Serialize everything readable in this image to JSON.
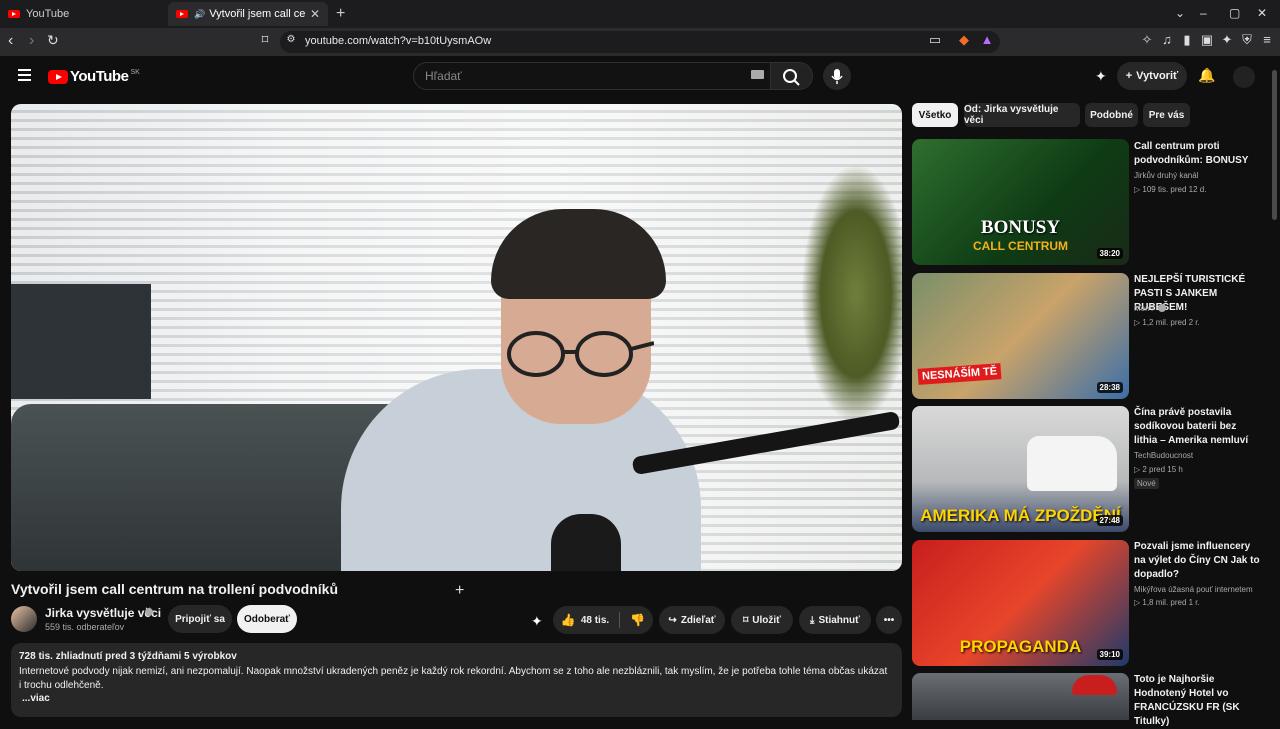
{
  "browser": {
    "tabs": [
      {
        "title": "YouTube"
      },
      {
        "title": "Vytvořil jsem call centrum na trol"
      }
    ],
    "url": "youtube.com/watch?v=b10tUysmAOw"
  },
  "header": {
    "logo_text": "YouTube",
    "region": "SK",
    "search_placeholder": "Hľadať",
    "create_label": "Vytvoriť"
  },
  "video": {
    "title": "Vytvořil jsem call centrum na trollení podvodníků",
    "channel": "Jirka vysvětluje věci",
    "subscribers": "559 tis. odberateľov",
    "join_label": "Pripojiť sa",
    "subscribe_label": "Odoberať",
    "likes": "48 tis.",
    "share_label": "Zdieľať",
    "save_label": "Uložiť",
    "download_label": "Stiahnuť",
    "description": {
      "meta": "728 tis. zhliadnutí  pred 3 týždňami  5 výrobkov",
      "text": "Internetové podvody nijak nemizí, ani nezpomalují. Naopak množství ukradených peněz je každý rok rekordní. Abychom se z toho ale nezbláznili, tak myslím, že je potřeba tohle téma občas ukázat i trochu odlehčeně.",
      "more": "...viac"
    }
  },
  "chips": [
    "Všetko",
    "Od: Jirka vysvětluje věci",
    "Podobné",
    "Pre vás"
  ],
  "recommendations": [
    {
      "title": "Call centrum proti podvodníkům: BONUSY",
      "channel": "Jirkův druhý kanál",
      "meta": "▷ 109 tis.   pred 12 d.",
      "duration": "38:20",
      "caption": "BONUSY",
      "caption2": "CALL CENTRUM"
    },
    {
      "title": "NEJLEPŠÍ TURISTICKÉ PASTI S JANKEM RUBEŠEM!",
      "channel": "MenT",
      "meta": "▷ 1,2 mil.   pred 2 r.",
      "duration": "28:38",
      "caption": "NESNÁŠÍM TĚ"
    },
    {
      "title": "Čína právě postavila sodíkovou baterii bez lithia – Amerika nemluví",
      "channel": "TechBudoucnost",
      "meta": "▷ 2   pred 15 h",
      "badge": "Nové",
      "duration": "27:48",
      "caption": "AMERIKA MÁ ZPOŽDĚNÍ"
    },
    {
      "title": "Pozvali jsme influencery na výlet do Číny CN Jak to dopadlo?",
      "channel": "Mikýřova úžasná pouť internetem",
      "meta": "▷ 1,8 mil.   pred 1 r.",
      "duration": "39:10",
      "caption": "PROPAGANDA"
    },
    {
      "title": "Toto je Najhoršie Hodnotený Hotel vo FRANCÚZSKU FR (SK Titulky)",
      "channel": "",
      "meta": ""
    }
  ]
}
